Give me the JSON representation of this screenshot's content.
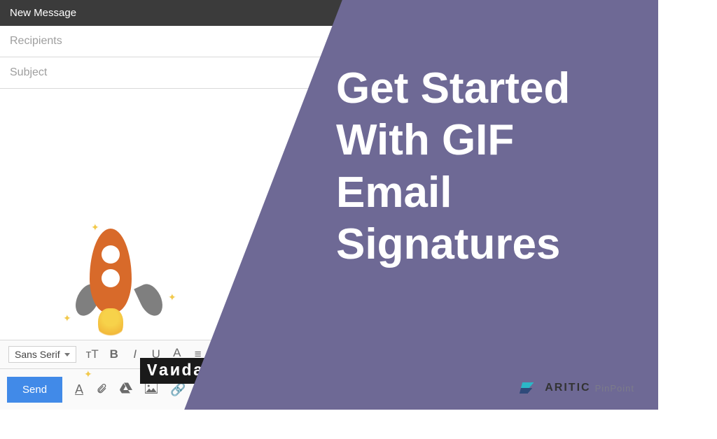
{
  "compose": {
    "title": "New Message",
    "recipients_placeholder": "Recipients",
    "subject_placeholder": "Subject",
    "signature_text": "Vaиdal"
  },
  "format_toolbar": {
    "font_family": "Sans Serif",
    "font_size_label": "тT",
    "bold": "B",
    "italic": "I",
    "underline": "U",
    "text_color": "A"
  },
  "action_toolbar": {
    "send": "Send",
    "text_style": "A"
  },
  "overlay": {
    "hero": "Get Started With GIF Email Signatures"
  },
  "brand": {
    "main": "ARITIC",
    "sub": "PinPoint"
  }
}
